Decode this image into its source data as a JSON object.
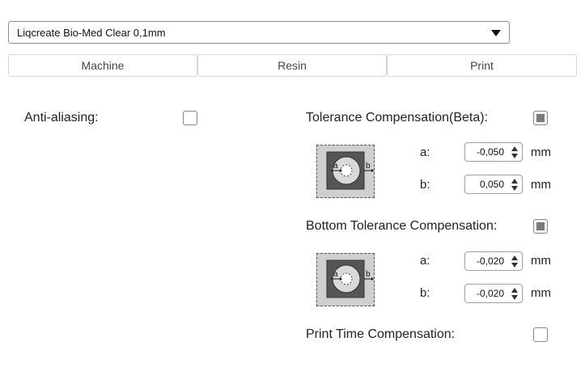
{
  "material_select": {
    "selected": "Liqcreate Bio-Med Clear 0,1mm"
  },
  "tabs": [
    {
      "label": "Machine"
    },
    {
      "label": "Resin"
    },
    {
      "label": "Print"
    }
  ],
  "anti_aliasing": {
    "label": "Anti-aliasing:",
    "checked": false
  },
  "tolerance": {
    "label": "Tolerance Compensation(Beta):",
    "checked": true,
    "a_label": "a:",
    "a_value": "-0,050",
    "b_label": "b:",
    "b_value": "0,050",
    "unit": "mm"
  },
  "bottom_tolerance": {
    "label": "Bottom Tolerance Compensation:",
    "checked": true,
    "a_label": "a:",
    "a_value": "-0,020",
    "b_label": "b:",
    "b_value": "-0,020",
    "unit": "mm"
  },
  "print_time": {
    "label": "Print Time Compensation:",
    "checked": false
  },
  "diagram": {
    "a_text": "a",
    "b_text": "b"
  }
}
